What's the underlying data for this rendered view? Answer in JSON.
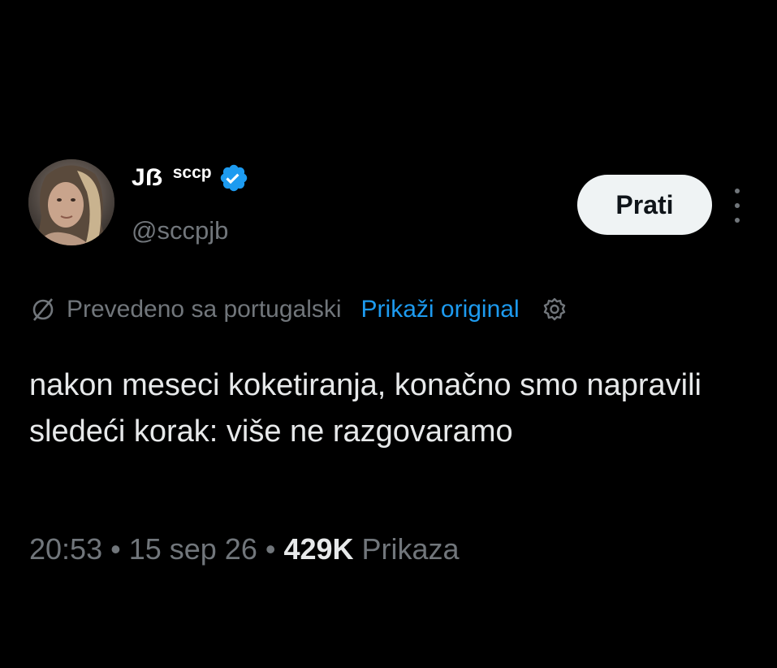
{
  "author": {
    "display_name": "Jẞ",
    "display_name_suffix": "sccp",
    "handle": "@sccpjb",
    "avatar_icon": "profile-photo",
    "verified_icon": "verified-badge-icon",
    "verified_color": "#1d9bf0"
  },
  "actions": {
    "follow_label": "Prati",
    "more_icon": "more-vertical-icon"
  },
  "translation": {
    "icon": "translate-icon",
    "label": "Prevedeno sa portugalski",
    "show_original_label": "Prikaži original",
    "settings_icon": "gear-icon"
  },
  "tweet": {
    "text": "nakon meseci koketiranja, konačno smo napravili sledeći korak: više ne razgovaramo",
    "time": "20:53",
    "separator": "•",
    "date": "15 sep 26",
    "views_count": "429K",
    "views_label": "Prikaza"
  },
  "colors": {
    "background": "#000000",
    "text": "#e7e9ea",
    "muted": "#71767b",
    "link": "#1d9bf0",
    "button_bg": "#eff3f4"
  }
}
